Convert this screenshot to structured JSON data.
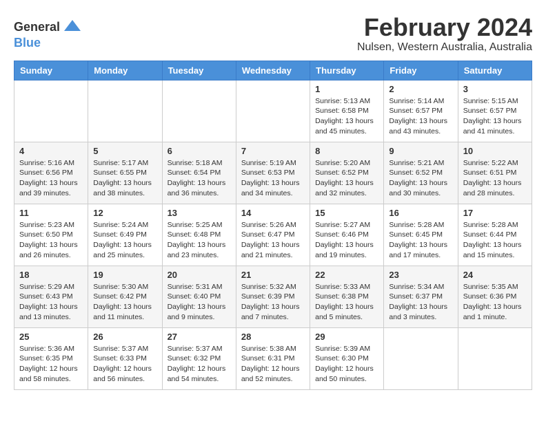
{
  "logo": {
    "general": "General",
    "blue": "Blue"
  },
  "title": "February 2024",
  "subtitle": "Nulsen, Western Australia, Australia",
  "headers": [
    "Sunday",
    "Monday",
    "Tuesday",
    "Wednesday",
    "Thursday",
    "Friday",
    "Saturday"
  ],
  "weeks": [
    [
      {
        "day": "",
        "info": ""
      },
      {
        "day": "",
        "info": ""
      },
      {
        "day": "",
        "info": ""
      },
      {
        "day": "",
        "info": ""
      },
      {
        "day": "1",
        "info": "Sunrise: 5:13 AM\nSunset: 6:58 PM\nDaylight: 13 hours\nand 45 minutes."
      },
      {
        "day": "2",
        "info": "Sunrise: 5:14 AM\nSunset: 6:57 PM\nDaylight: 13 hours\nand 43 minutes."
      },
      {
        "day": "3",
        "info": "Sunrise: 5:15 AM\nSunset: 6:57 PM\nDaylight: 13 hours\nand 41 minutes."
      }
    ],
    [
      {
        "day": "4",
        "info": "Sunrise: 5:16 AM\nSunset: 6:56 PM\nDaylight: 13 hours\nand 39 minutes."
      },
      {
        "day": "5",
        "info": "Sunrise: 5:17 AM\nSunset: 6:55 PM\nDaylight: 13 hours\nand 38 minutes."
      },
      {
        "day": "6",
        "info": "Sunrise: 5:18 AM\nSunset: 6:54 PM\nDaylight: 13 hours\nand 36 minutes."
      },
      {
        "day": "7",
        "info": "Sunrise: 5:19 AM\nSunset: 6:53 PM\nDaylight: 13 hours\nand 34 minutes."
      },
      {
        "day": "8",
        "info": "Sunrise: 5:20 AM\nSunset: 6:52 PM\nDaylight: 13 hours\nand 32 minutes."
      },
      {
        "day": "9",
        "info": "Sunrise: 5:21 AM\nSunset: 6:52 PM\nDaylight: 13 hours\nand 30 minutes."
      },
      {
        "day": "10",
        "info": "Sunrise: 5:22 AM\nSunset: 6:51 PM\nDaylight: 13 hours\nand 28 minutes."
      }
    ],
    [
      {
        "day": "11",
        "info": "Sunrise: 5:23 AM\nSunset: 6:50 PM\nDaylight: 13 hours\nand 26 minutes."
      },
      {
        "day": "12",
        "info": "Sunrise: 5:24 AM\nSunset: 6:49 PM\nDaylight: 13 hours\nand 25 minutes."
      },
      {
        "day": "13",
        "info": "Sunrise: 5:25 AM\nSunset: 6:48 PM\nDaylight: 13 hours\nand 23 minutes."
      },
      {
        "day": "14",
        "info": "Sunrise: 5:26 AM\nSunset: 6:47 PM\nDaylight: 13 hours\nand 21 minutes."
      },
      {
        "day": "15",
        "info": "Sunrise: 5:27 AM\nSunset: 6:46 PM\nDaylight: 13 hours\nand 19 minutes."
      },
      {
        "day": "16",
        "info": "Sunrise: 5:28 AM\nSunset: 6:45 PM\nDaylight: 13 hours\nand 17 minutes."
      },
      {
        "day": "17",
        "info": "Sunrise: 5:28 AM\nSunset: 6:44 PM\nDaylight: 13 hours\nand 15 minutes."
      }
    ],
    [
      {
        "day": "18",
        "info": "Sunrise: 5:29 AM\nSunset: 6:43 PM\nDaylight: 13 hours\nand 13 minutes."
      },
      {
        "day": "19",
        "info": "Sunrise: 5:30 AM\nSunset: 6:42 PM\nDaylight: 13 hours\nand 11 minutes."
      },
      {
        "day": "20",
        "info": "Sunrise: 5:31 AM\nSunset: 6:40 PM\nDaylight: 13 hours\nand 9 minutes."
      },
      {
        "day": "21",
        "info": "Sunrise: 5:32 AM\nSunset: 6:39 PM\nDaylight: 13 hours\nand 7 minutes."
      },
      {
        "day": "22",
        "info": "Sunrise: 5:33 AM\nSunset: 6:38 PM\nDaylight: 13 hours\nand 5 minutes."
      },
      {
        "day": "23",
        "info": "Sunrise: 5:34 AM\nSunset: 6:37 PM\nDaylight: 13 hours\nand 3 minutes."
      },
      {
        "day": "24",
        "info": "Sunrise: 5:35 AM\nSunset: 6:36 PM\nDaylight: 13 hours\nand 1 minute."
      }
    ],
    [
      {
        "day": "25",
        "info": "Sunrise: 5:36 AM\nSunset: 6:35 PM\nDaylight: 12 hours\nand 58 minutes."
      },
      {
        "day": "26",
        "info": "Sunrise: 5:37 AM\nSunset: 6:33 PM\nDaylight: 12 hours\nand 56 minutes."
      },
      {
        "day": "27",
        "info": "Sunrise: 5:37 AM\nSunset: 6:32 PM\nDaylight: 12 hours\nand 54 minutes."
      },
      {
        "day": "28",
        "info": "Sunrise: 5:38 AM\nSunset: 6:31 PM\nDaylight: 12 hours\nand 52 minutes."
      },
      {
        "day": "29",
        "info": "Sunrise: 5:39 AM\nSunset: 6:30 PM\nDaylight: 12 hours\nand 50 minutes."
      },
      {
        "day": "",
        "info": ""
      },
      {
        "day": "",
        "info": ""
      }
    ]
  ]
}
